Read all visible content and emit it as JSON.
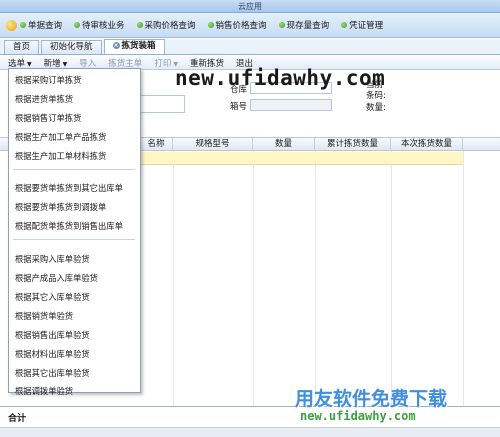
{
  "window": {
    "title": "云应用"
  },
  "nav": {
    "items": [
      "单据查询",
      "待审核业务",
      "采购价格查询",
      "销售价格查询",
      "现存量查询",
      "凭证管理"
    ]
  },
  "tabs": [
    {
      "label": "首页"
    },
    {
      "label": "初始化导航"
    },
    {
      "label": "拣货装箱"
    }
  ],
  "toolbar": {
    "select_label": "选单",
    "add_label": "新增",
    "import_label": "导入",
    "pick_main_label": "拣货主单",
    "print_label": "打印",
    "repick_label": "重新拣货",
    "exit_label": "退出"
  },
  "form": {
    "warehouse_label": "仓库",
    "box_no_label": "箱号",
    "current_label": "当前",
    "barcode_label": "条码:",
    "quantity_label": "数量:"
  },
  "grid": {
    "columns": [
      "名称",
      "规格型号",
      "数量",
      "累计拣货数量",
      "本次拣货数量"
    ]
  },
  "footer": {
    "total_label": "合计"
  },
  "menu": {
    "group1": [
      "根据采购订单拣货",
      "根据进货单拣货",
      "根据销售订单拣货",
      "根据生产加工单产品拣货",
      "根据生产加工单材料拣货"
    ],
    "group2": [
      "根据要货单拣货到其它出库单",
      "根据要货单拣货到调拨单",
      "根据配货单拣货到销售出库单"
    ],
    "group3": [
      "根据采购入库单验货",
      "根据产成品入库单验货",
      "根据其它入库单验货",
      "根据销货单验货",
      "根据销售出库单验货",
      "根据材料出库单验货",
      "根据其它出库单验货",
      "根据调拨单验货"
    ]
  },
  "watermark": {
    "top": "new.ufidawhy.com",
    "brand": "用友软件免费下载",
    "url": "new.ufidawhy.com"
  }
}
